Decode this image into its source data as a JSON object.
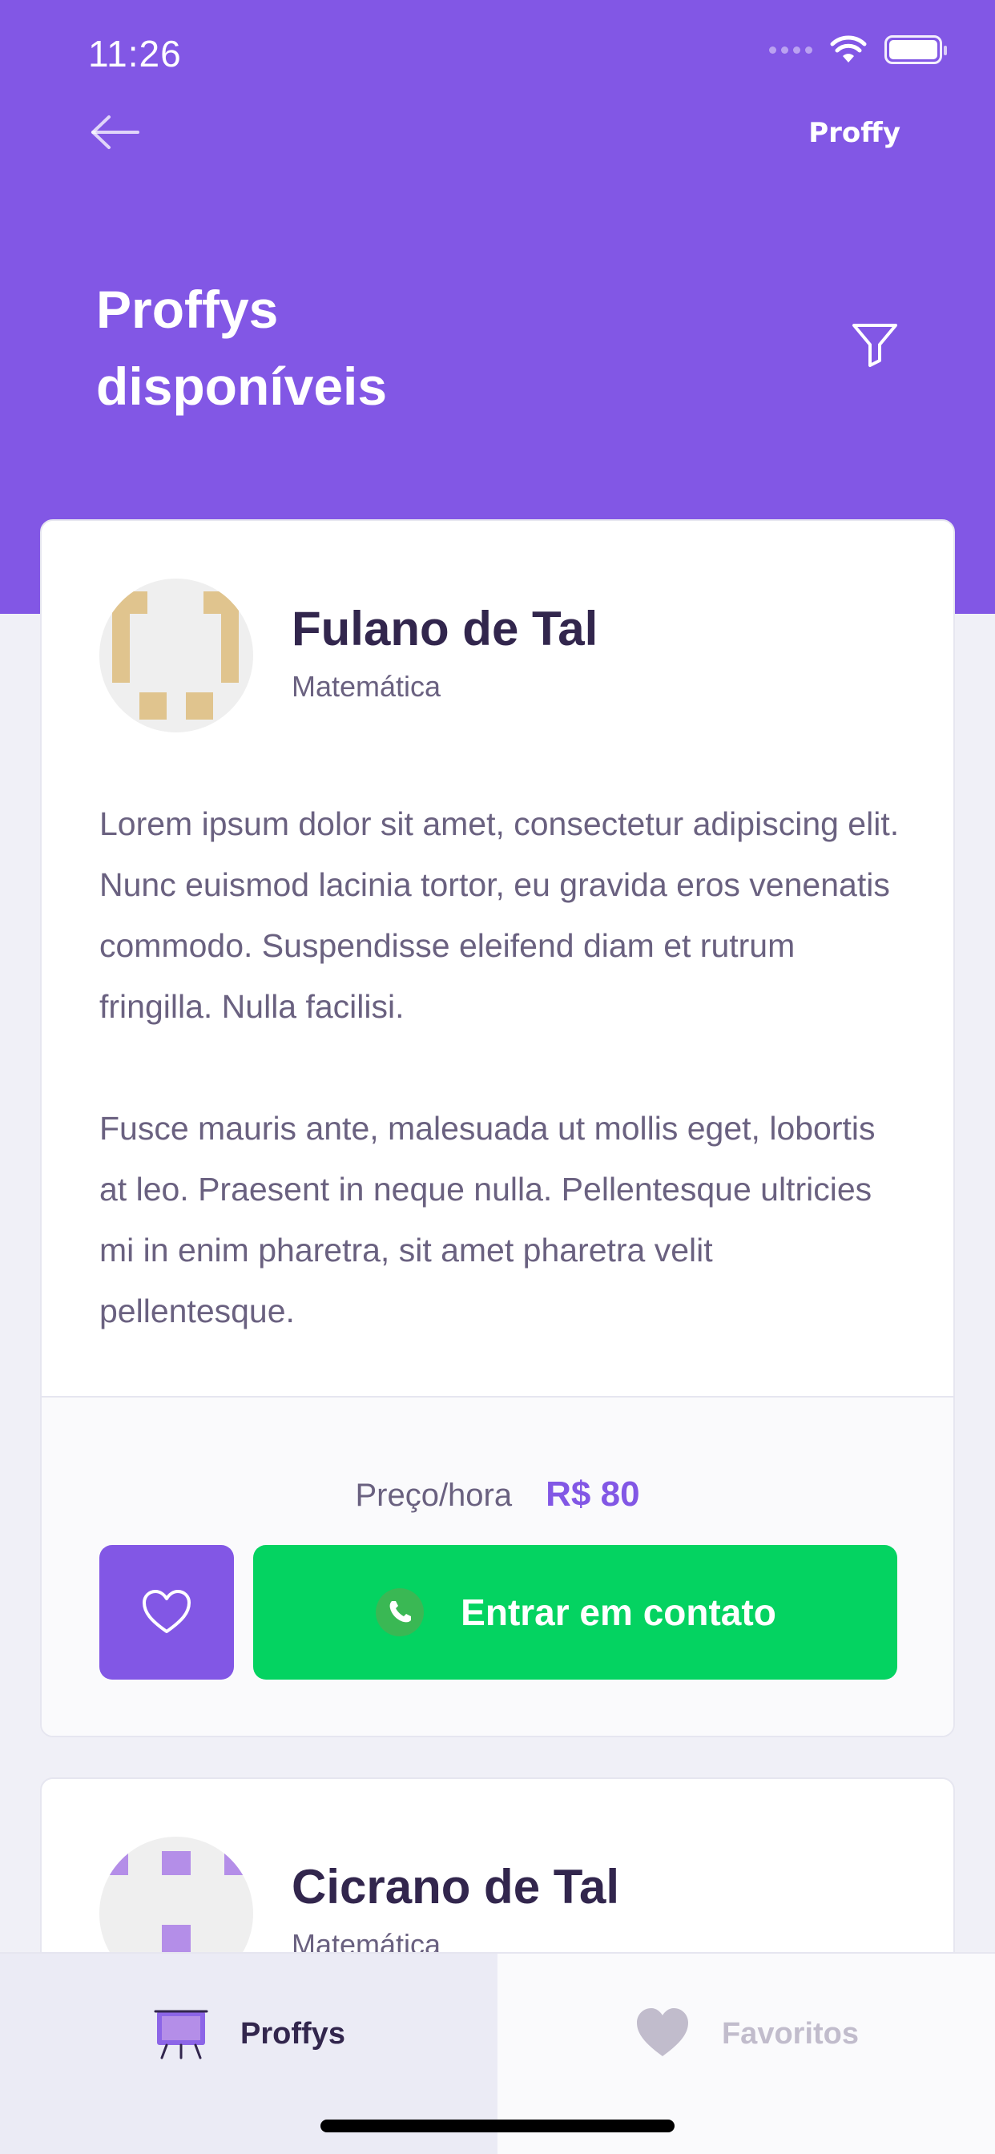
{
  "status_bar": {
    "time": "11:26"
  },
  "header": {
    "brand": "Proffy",
    "title_line1": "Proffys",
    "title_line2": "disponíveis"
  },
  "teachers": [
    {
      "name": "Fulano de Tal",
      "subject": "Matemática",
      "bio": [
        "Lorem ipsum dolor sit amet, consectetur adipiscing elit. Nunc euismod lacinia tortor, eu gravida eros venenatis commodo. Suspendisse eleifend diam et rutrum fringilla. Nulla facilisi.",
        "Fusce mauris ante, malesuada ut mollis eget, lobortis at leo. Praesent in neque nulla. Pellentesque ultricies mi in enim pharetra, sit amet pharetra velit pellentesque."
      ],
      "price_label": "Preço/hora",
      "price_value": "R$ 80",
      "contact_label": "Entrar em contato"
    },
    {
      "name": "Cicrano de Tal",
      "subject": "Matemática"
    }
  ],
  "tabs": [
    {
      "label": "Proffys",
      "icon": "easel-icon",
      "active": true
    },
    {
      "label": "Favoritos",
      "icon": "heart-icon",
      "active": false
    }
  ],
  "colors": {
    "primary": "#8257E5",
    "secondary": "#04D361",
    "background": "#F0F0F7",
    "title_text": "#32264D",
    "body_text": "#6A6180",
    "inactive_text": "#C1BCCC",
    "avatar1_accent": "#E0C48E",
    "avatar2_accent": "#B48EE8"
  }
}
